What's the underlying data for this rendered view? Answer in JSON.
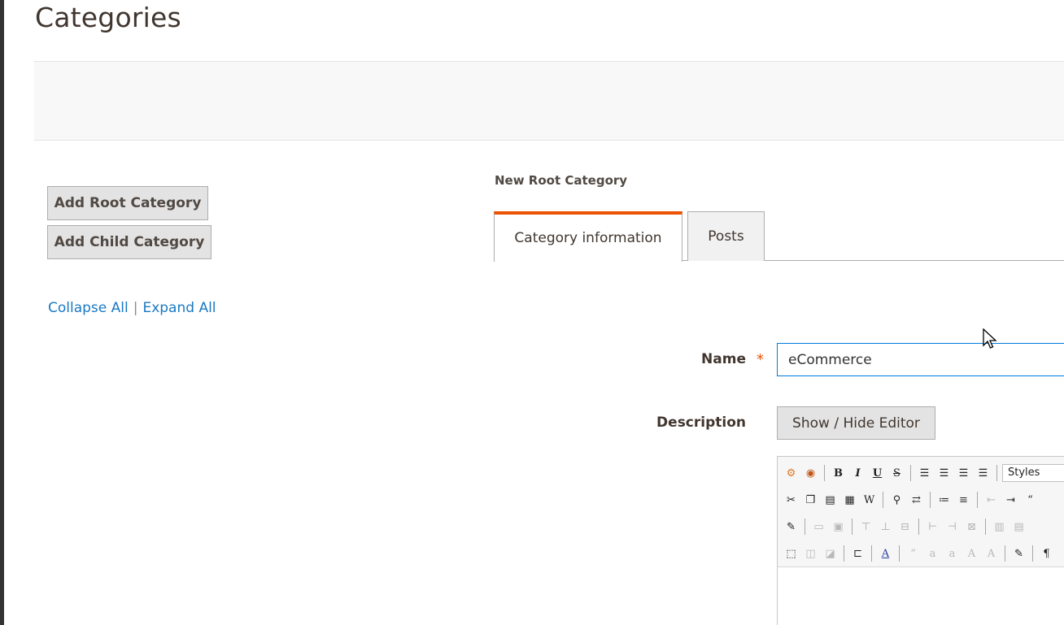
{
  "page": {
    "title": "Categories"
  },
  "buttons": {
    "add_root": "Add Root Category",
    "add_child": "Add Child Category"
  },
  "tree": {
    "collapse_all": "Collapse All",
    "separator": "|",
    "expand_all": "Expand All"
  },
  "form": {
    "section_title": "New Root Category",
    "tabs": [
      {
        "label": "Category information",
        "active": true
      },
      {
        "label": "Posts",
        "active": false
      }
    ],
    "name": {
      "label": "Name",
      "required_mark": "*",
      "value": "eCommerce"
    },
    "description": {
      "label": "Description",
      "toggle_editor": "Show / Hide Editor"
    }
  },
  "editor": {
    "toolbar": {
      "row1": [
        {
          "icon": "magento-widget-icon",
          "glyph": "⚙",
          "dim": false
        },
        {
          "icon": "insert-image-icon",
          "glyph": "◉",
          "dim": false
        },
        {
          "icon": "bold-icon",
          "glyph": "B",
          "dim": false
        },
        {
          "icon": "italic-icon",
          "glyph": "I",
          "dim": false
        },
        {
          "icon": "underline-icon",
          "glyph": "U",
          "dim": false
        },
        {
          "icon": "strikethrough-icon",
          "glyph": "S",
          "dim": false
        },
        {
          "icon": "align-left-icon",
          "glyph": "☰",
          "dim": false
        },
        {
          "icon": "align-center-icon",
          "glyph": "☰",
          "dim": false
        },
        {
          "icon": "align-right-icon",
          "glyph": "☰",
          "dim": false
        },
        {
          "icon": "align-justify-icon",
          "glyph": "☰",
          "dim": false
        }
      ],
      "styles_select": "Styles",
      "row2": [
        {
          "icon": "cut-icon",
          "glyph": "✂",
          "dim": false
        },
        {
          "icon": "copy-icon",
          "glyph": "❐",
          "dim": false
        },
        {
          "icon": "paste-icon",
          "glyph": "▤",
          "dim": false
        },
        {
          "icon": "paste-text-icon",
          "glyph": "▦",
          "dim": false
        },
        {
          "icon": "paste-word-icon",
          "glyph": "W",
          "dim": false
        },
        {
          "icon": "find-icon",
          "glyph": "⚲",
          "dim": false
        },
        {
          "icon": "replace-icon",
          "glyph": "⇄",
          "dim": false
        },
        {
          "icon": "bullet-list-icon",
          "glyph": "≔",
          "dim": false
        },
        {
          "icon": "numbered-list-icon",
          "glyph": "≡",
          "dim": false
        },
        {
          "icon": "outdent-icon",
          "glyph": "⇤",
          "dim": true
        },
        {
          "icon": "indent-icon",
          "glyph": "⇥",
          "dim": false
        },
        {
          "icon": "blockquote-icon",
          "glyph": "“",
          "dim": false
        }
      ],
      "row3": [
        {
          "icon": "edit-table-icon",
          "glyph": "✎",
          "dim": false
        },
        {
          "icon": "row-props-icon",
          "glyph": "▭",
          "dim": true
        },
        {
          "icon": "cell-props-icon",
          "glyph": "▣",
          "dim": true
        },
        {
          "icon": "insert-row-before-icon",
          "glyph": "⊤",
          "dim": true
        },
        {
          "icon": "insert-row-after-icon",
          "glyph": "⊥",
          "dim": true
        },
        {
          "icon": "delete-row-icon",
          "glyph": "⊟",
          "dim": true
        },
        {
          "icon": "insert-col-before-icon",
          "glyph": "⊢",
          "dim": true
        },
        {
          "icon": "insert-col-after-icon",
          "glyph": "⊣",
          "dim": true
        },
        {
          "icon": "delete-col-icon",
          "glyph": "⊠",
          "dim": true
        },
        {
          "icon": "split-cells-icon",
          "glyph": "▥",
          "dim": true
        },
        {
          "icon": "merge-cells-icon",
          "glyph": "▤",
          "dim": true
        }
      ],
      "row4": [
        {
          "icon": "visual-aid-icon",
          "glyph": "⬚",
          "dim": false
        },
        {
          "icon": "move-forward-icon",
          "glyph": "◫",
          "dim": true
        },
        {
          "icon": "move-backward-icon",
          "glyph": "◪",
          "dim": true
        },
        {
          "icon": "absolute-icon",
          "glyph": "⊏",
          "dim": false
        },
        {
          "icon": "styleprops-icon",
          "glyph": "A",
          "dim": false
        },
        {
          "icon": "cite-icon",
          "glyph": "“",
          "dim": true
        },
        {
          "icon": "abbr-icon",
          "glyph": "a",
          "dim": true
        },
        {
          "icon": "acronym-icon",
          "glyph": "a",
          "dim": true
        },
        {
          "icon": "del-icon",
          "glyph": "A",
          "dim": true
        },
        {
          "icon": "ins-icon",
          "glyph": "A",
          "dim": true
        },
        {
          "icon": "attributes-icon",
          "glyph": "✎",
          "dim": false
        },
        {
          "icon": "paragraph-icon",
          "glyph": "¶",
          "dim": false
        }
      ]
    }
  },
  "colors": {
    "accent": "#eb5202",
    "link": "#1979c3",
    "focus": "#007bdb"
  }
}
